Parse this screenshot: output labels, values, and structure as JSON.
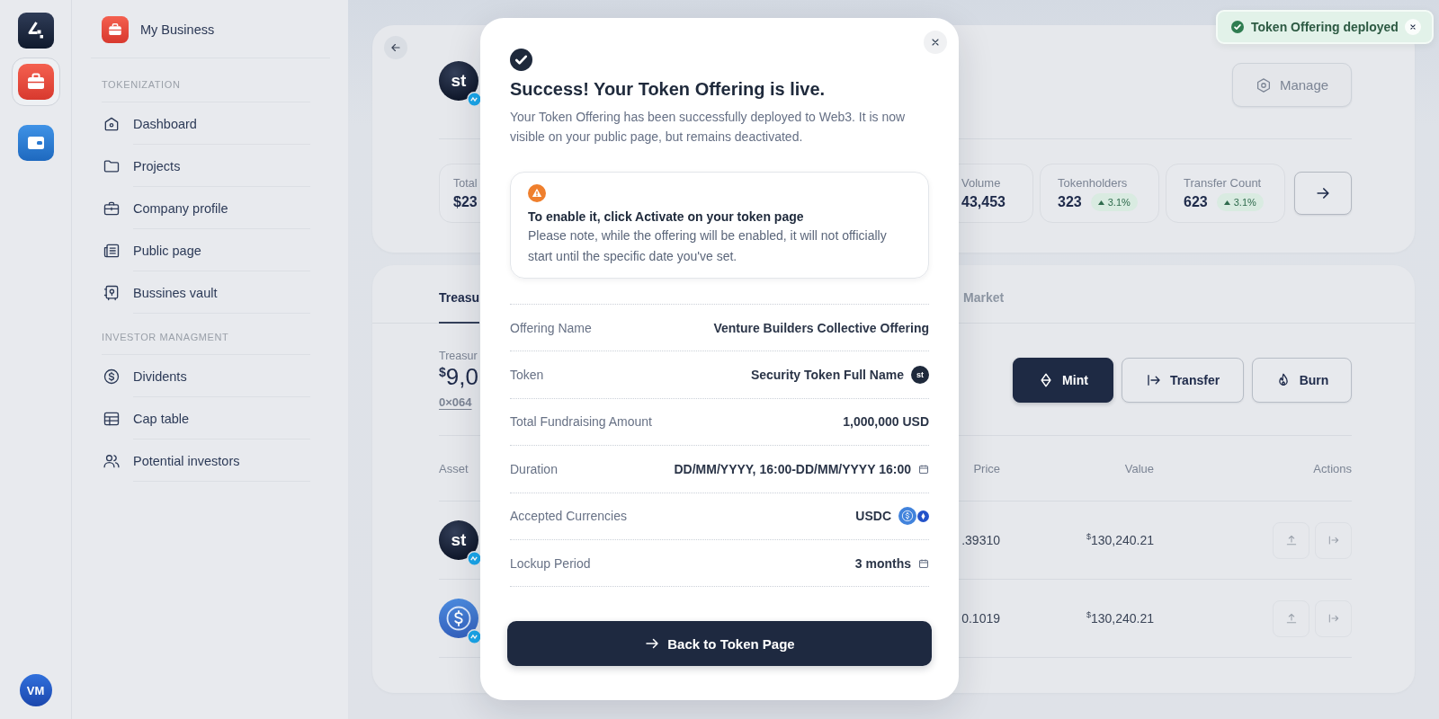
{
  "rail": {
    "apps": [
      {
        "selected": true
      },
      {
        "selected": false
      }
    ],
    "avatar": "VM"
  },
  "sidebar": {
    "title": "My Business",
    "sections": [
      {
        "label": "TOKENIZATION",
        "items": [
          "Dashboard",
          "Projects",
          "Company profile",
          "Public page",
          "Bussines vault"
        ]
      },
      {
        "label": "INVESTOR MANAGMENT",
        "items": [
          "Dividents",
          "Cap table",
          "Potential investors"
        ]
      }
    ]
  },
  "token_header": {
    "avatar_text": "st",
    "manage_button": "Manage",
    "stats": [
      {
        "label": "Total",
        "value": "$23"
      },
      {
        "label": "Volume",
        "value": "43,453"
      },
      {
        "label": "Tokenholders",
        "value": "323",
        "change": "3.1%"
      },
      {
        "label": "Transfer Count",
        "value": "623",
        "change": "3.1%"
      }
    ]
  },
  "tabs": [
    {
      "label": "Treasu",
      "selected": true
    },
    {
      "label": "Market",
      "selected": false
    }
  ],
  "treasury": {
    "label": "Treasur",
    "currency": "$",
    "amount": "9,0",
    "address": "0×064",
    "actions": [
      {
        "label": "Mint",
        "primary": true
      },
      {
        "label": "Transfer",
        "primary": false
      },
      {
        "label": "Burn",
        "primary": false
      }
    ]
  },
  "table": {
    "columns": [
      "Asset",
      "Price",
      "Value",
      "Actions"
    ],
    "rows": [
      {
        "avatar_text": "st",
        "price": ".39310",
        "currency": "$",
        "value": "130,240.21"
      },
      {
        "price": "0.1019",
        "currency": "$",
        "value": "130,240.21"
      }
    ]
  },
  "modal": {
    "title": "Success! Your Token Offering is live.",
    "description": "Your Token Offering has been successfully deployed to Web3. It is now visible on your public page, but remains deactivated.",
    "notice": {
      "title": "To enable it, click Activate on your token page",
      "body": "Please note, while the offering will be enabled, it will not officially start until the specific date you've set."
    },
    "details": [
      {
        "label": "Offering Name",
        "value": "Venture Builders Collective Offering",
        "kind": "plain"
      },
      {
        "label": "Token",
        "value": "Security Token Full Name",
        "kind": "token",
        "token_text": "st"
      },
      {
        "label": "Total Fundraising Amount",
        "value": "1,000,000 USD",
        "kind": "plain"
      },
      {
        "label": "Duration",
        "value": "DD/MM/YYYY, 16:00-DD/MM/YYYY 16:00",
        "kind": "date"
      },
      {
        "label": "Accepted Currencies",
        "value": "USDC",
        "kind": "currency"
      },
      {
        "label": "Lockup Period",
        "value": "3 months",
        "kind": "date"
      }
    ],
    "button": "Back to Token Page"
  },
  "toast": {
    "message": "Token Offering deployed"
  }
}
